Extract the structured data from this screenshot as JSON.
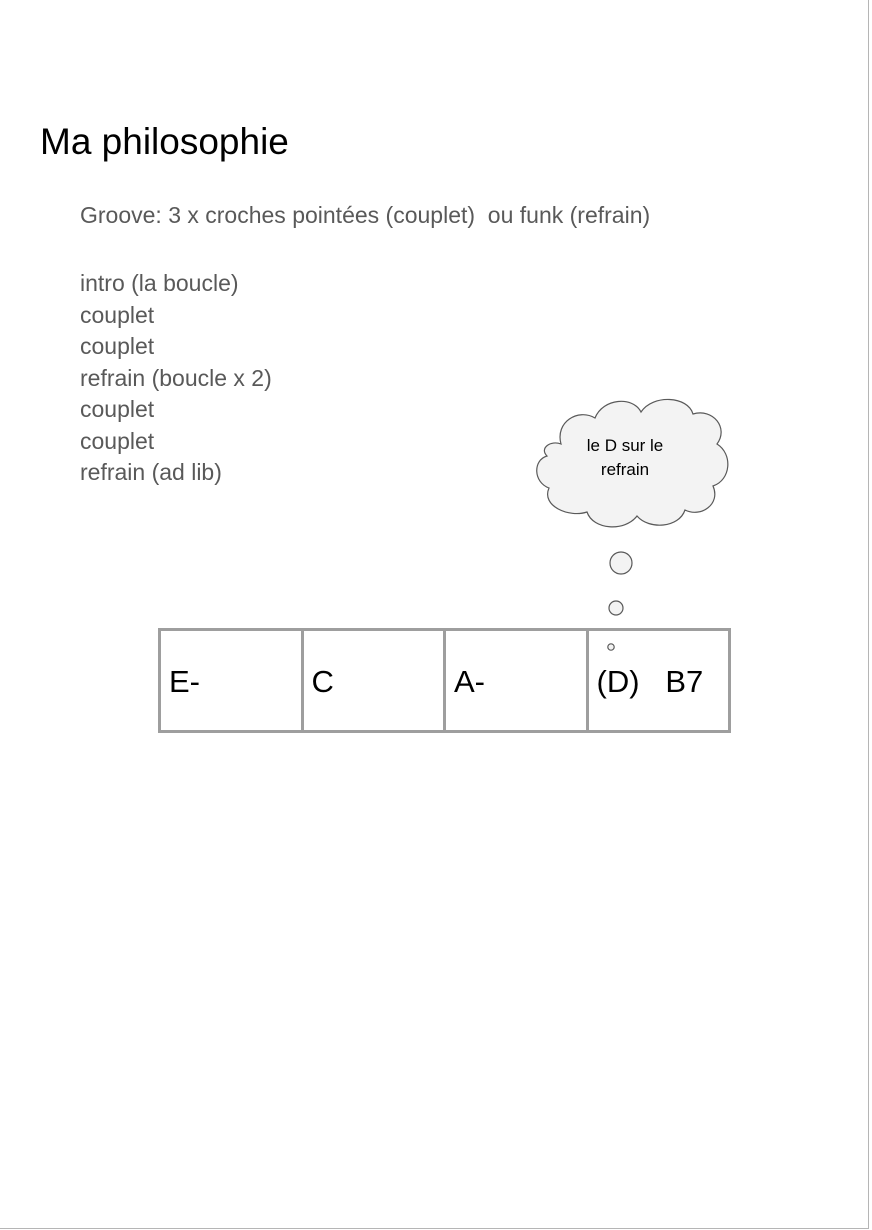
{
  "title": "Ma philosophie",
  "groove": "Groove: 3 x croches pointées (couplet)  ou funk (refrain)",
  "structure": [
    "intro (la boucle)",
    "couplet",
    "couplet",
    "refrain (boucle x 2)",
    "couplet",
    "couplet",
    "refrain (ad lib)"
  ],
  "thought_bubble": {
    "line1": "le D sur le",
    "line2": "refrain"
  },
  "chords": [
    "E-",
    "C",
    "A-",
    "(D)   B7"
  ]
}
